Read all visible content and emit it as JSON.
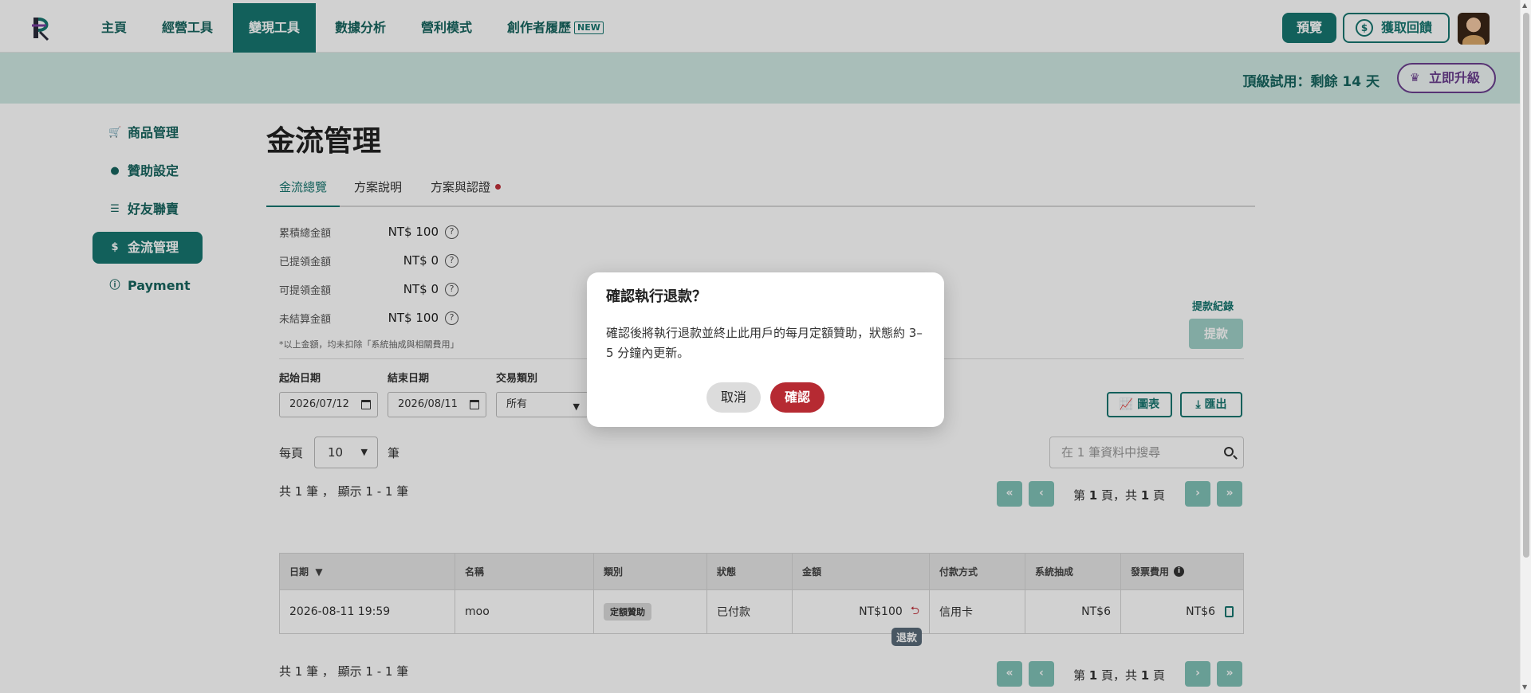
{
  "nav": {
    "items": [
      "主頁",
      "經營工具",
      "變現工具",
      "數據分析",
      "營利模式",
      "創作者履歷"
    ],
    "new_badge": "NEW",
    "preview": "預覽",
    "feedback": "獲取回饋"
  },
  "trial": {
    "text": "頂級試用：剩餘 14 天",
    "upgrade": "立即升級"
  },
  "sidebar": {
    "items": [
      "商品管理",
      "贊助設定",
      "好友聯賣",
      "金流管理",
      "Payment"
    ]
  },
  "main": {
    "title": "金流管理",
    "tabs": [
      "金流總覽",
      "方案說明",
      "方案與認證"
    ],
    "summary": [
      {
        "label": "累積總金額",
        "value": "NT$ 100"
      },
      {
        "label": "已提領金額",
        "value": "NT$ 0"
      },
      {
        "label": "可提領金額",
        "value": "NT$ 0"
      },
      {
        "label": "未結算金額",
        "value": "NT$ 100"
      }
    ],
    "note": "*以上金額，均未扣除「系統抽成與相關費用」",
    "withdraw_record": "提款紀錄",
    "withdraw": "提款",
    "filters": {
      "start_label": "起始日期",
      "start_value": "2026/07/12",
      "end_label": "結束日期",
      "end_value": "2026/08/11",
      "type_label": "交易類別",
      "type_value": "所有"
    },
    "chart_btn": "圖表",
    "export_btn": "匯出",
    "per_page_label": "每頁",
    "per_page_value": "10",
    "per_page_unit": "筆",
    "search_placeholder": "在 1 筆資料中搜尋",
    "count_text": "共 1 筆 ， 顯示 1 - 1 筆",
    "pagination": {
      "prefix": "第 ",
      "page": "1",
      "mid": " 頁，共 ",
      "total": "1",
      "suffix": " 頁"
    },
    "table": {
      "headers": [
        "日期",
        "名稱",
        "類別",
        "狀態",
        "金額",
        "付款方式",
        "系統抽成",
        "發票費用"
      ],
      "rows": [
        {
          "date": "2026-08-11 19:59",
          "name": "moo",
          "category": "定額贊助",
          "status": "已付款",
          "amount": "NT$100",
          "method": "信用卡",
          "fee": "NT$6",
          "invoice": "NT$6"
        }
      ]
    },
    "tooltip": "退款"
  },
  "modal": {
    "title": "確認執行退款？",
    "body": "確認後將執行退款並終止此用戶的每月定額贊助，狀態約 3–5 分鐘內更新。",
    "cancel": "取消",
    "confirm": "確認"
  },
  "colors": {
    "primary": "#17766f",
    "danger": "#b62a32",
    "trial_bg": "#cfe8e2",
    "upgrade": "#6b3f8e"
  }
}
